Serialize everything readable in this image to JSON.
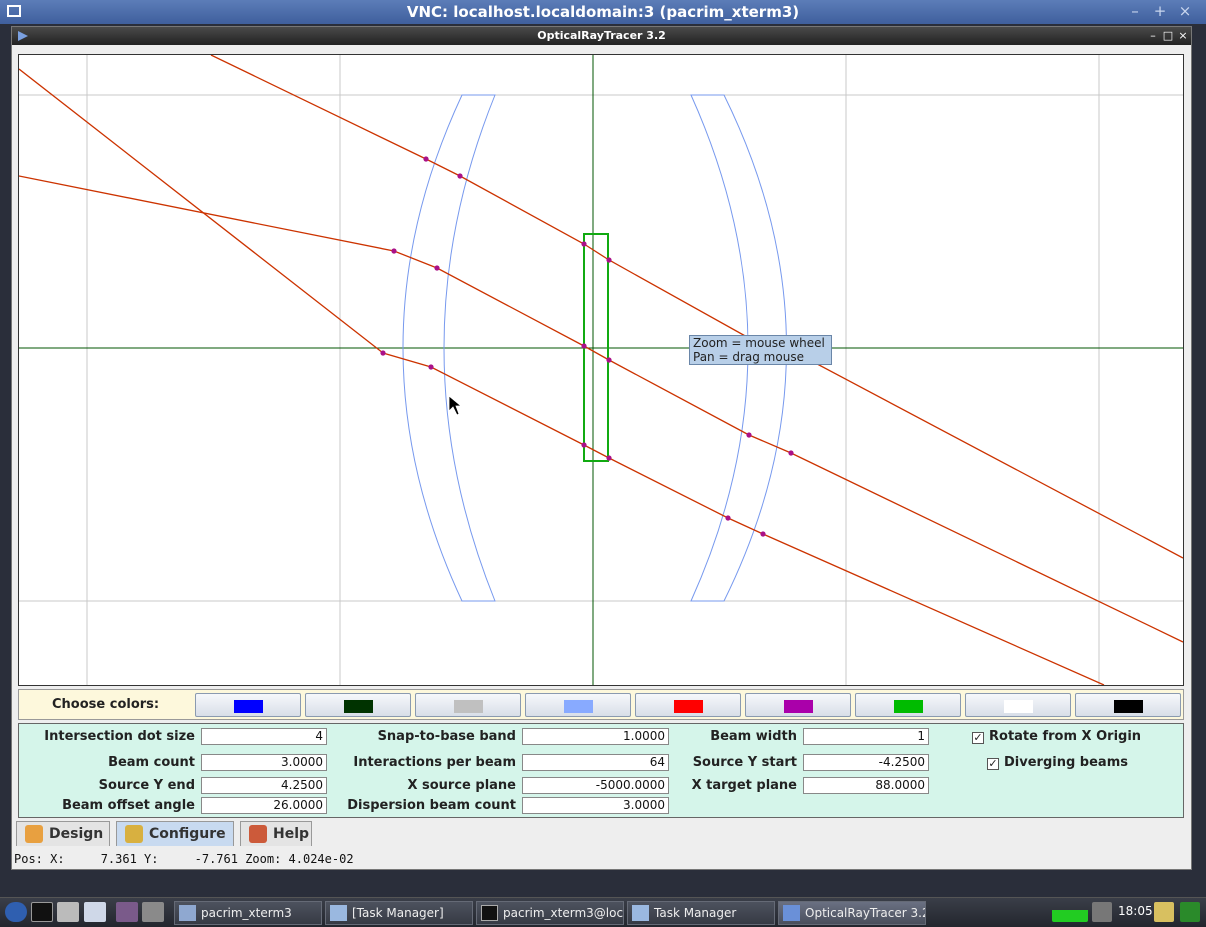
{
  "vnc": {
    "title": "VNC: localhost.localdomain:3 (pacrim_xterm3)",
    "minimize": "–",
    "maximize": "+",
    "close": "×"
  },
  "app": {
    "title": "OpticalRayTracer 3.2",
    "minimize": "–",
    "maximize": "□",
    "close": "×"
  },
  "tooltip": {
    "line1": "Zoom = mouse wheel",
    "line2": "Pan = drag mouse"
  },
  "colors": {
    "label": "Choose colors:",
    "swatches": [
      "#0000ff",
      "#003300",
      "#c0c0c0",
      "#88aaff",
      "#ff0000",
      "#aa00aa",
      "#00bb00",
      "#ffffff",
      "#000000"
    ]
  },
  "config": {
    "intersection_dot_size": {
      "label": "Intersection dot size",
      "value": "4"
    },
    "beam_count": {
      "label": "Beam count",
      "value": "3.0000"
    },
    "source_y_end": {
      "label": "Source Y end",
      "value": "4.2500"
    },
    "beam_offset_angle": {
      "label": "Beam offset angle",
      "value": "26.0000"
    },
    "snap_to_base_band": {
      "label": "Snap-to-base band",
      "value": "1.0000"
    },
    "interactions_per_beam": {
      "label": "Interactions per beam",
      "value": "64"
    },
    "x_source_plane": {
      "label": "X source plane",
      "value": "-5000.0000"
    },
    "dispersion_beam_count": {
      "label": "Dispersion beam count",
      "value": "3.0000"
    },
    "beam_width": {
      "label": "Beam width",
      "value": "1"
    },
    "source_y_start": {
      "label": "Source Y start",
      "value": "-4.2500"
    },
    "x_target_plane": {
      "label": "X target plane",
      "value": "88.0000"
    },
    "rotate_from_x_origin": {
      "label": "Rotate from X Origin",
      "checked": true
    },
    "diverging_beams": {
      "label": "Diverging beams",
      "checked": true
    }
  },
  "tabs": [
    {
      "label": "Design"
    },
    {
      "label": "Configure"
    },
    {
      "label": "Help"
    }
  ],
  "status": "Pos: X:     7.361 Y:     -7.761 Zoom: 4.024e-02",
  "taskbar": {
    "tasks": [
      {
        "label": "pacrim_xterm3"
      },
      {
        "label": "[Task Manager]"
      },
      {
        "label": "pacrim_xterm3@loc..."
      },
      {
        "label": "Task Manager"
      },
      {
        "label": "OpticalRayTracer 3.2"
      }
    ],
    "clock": "18:05"
  },
  "colors_theme": {
    "ray": "#cc3300",
    "lens": "#7799ee",
    "axis": "#005500",
    "grid": "#c0c0c0",
    "dot": "#aa1188",
    "object": "#11aa11"
  }
}
